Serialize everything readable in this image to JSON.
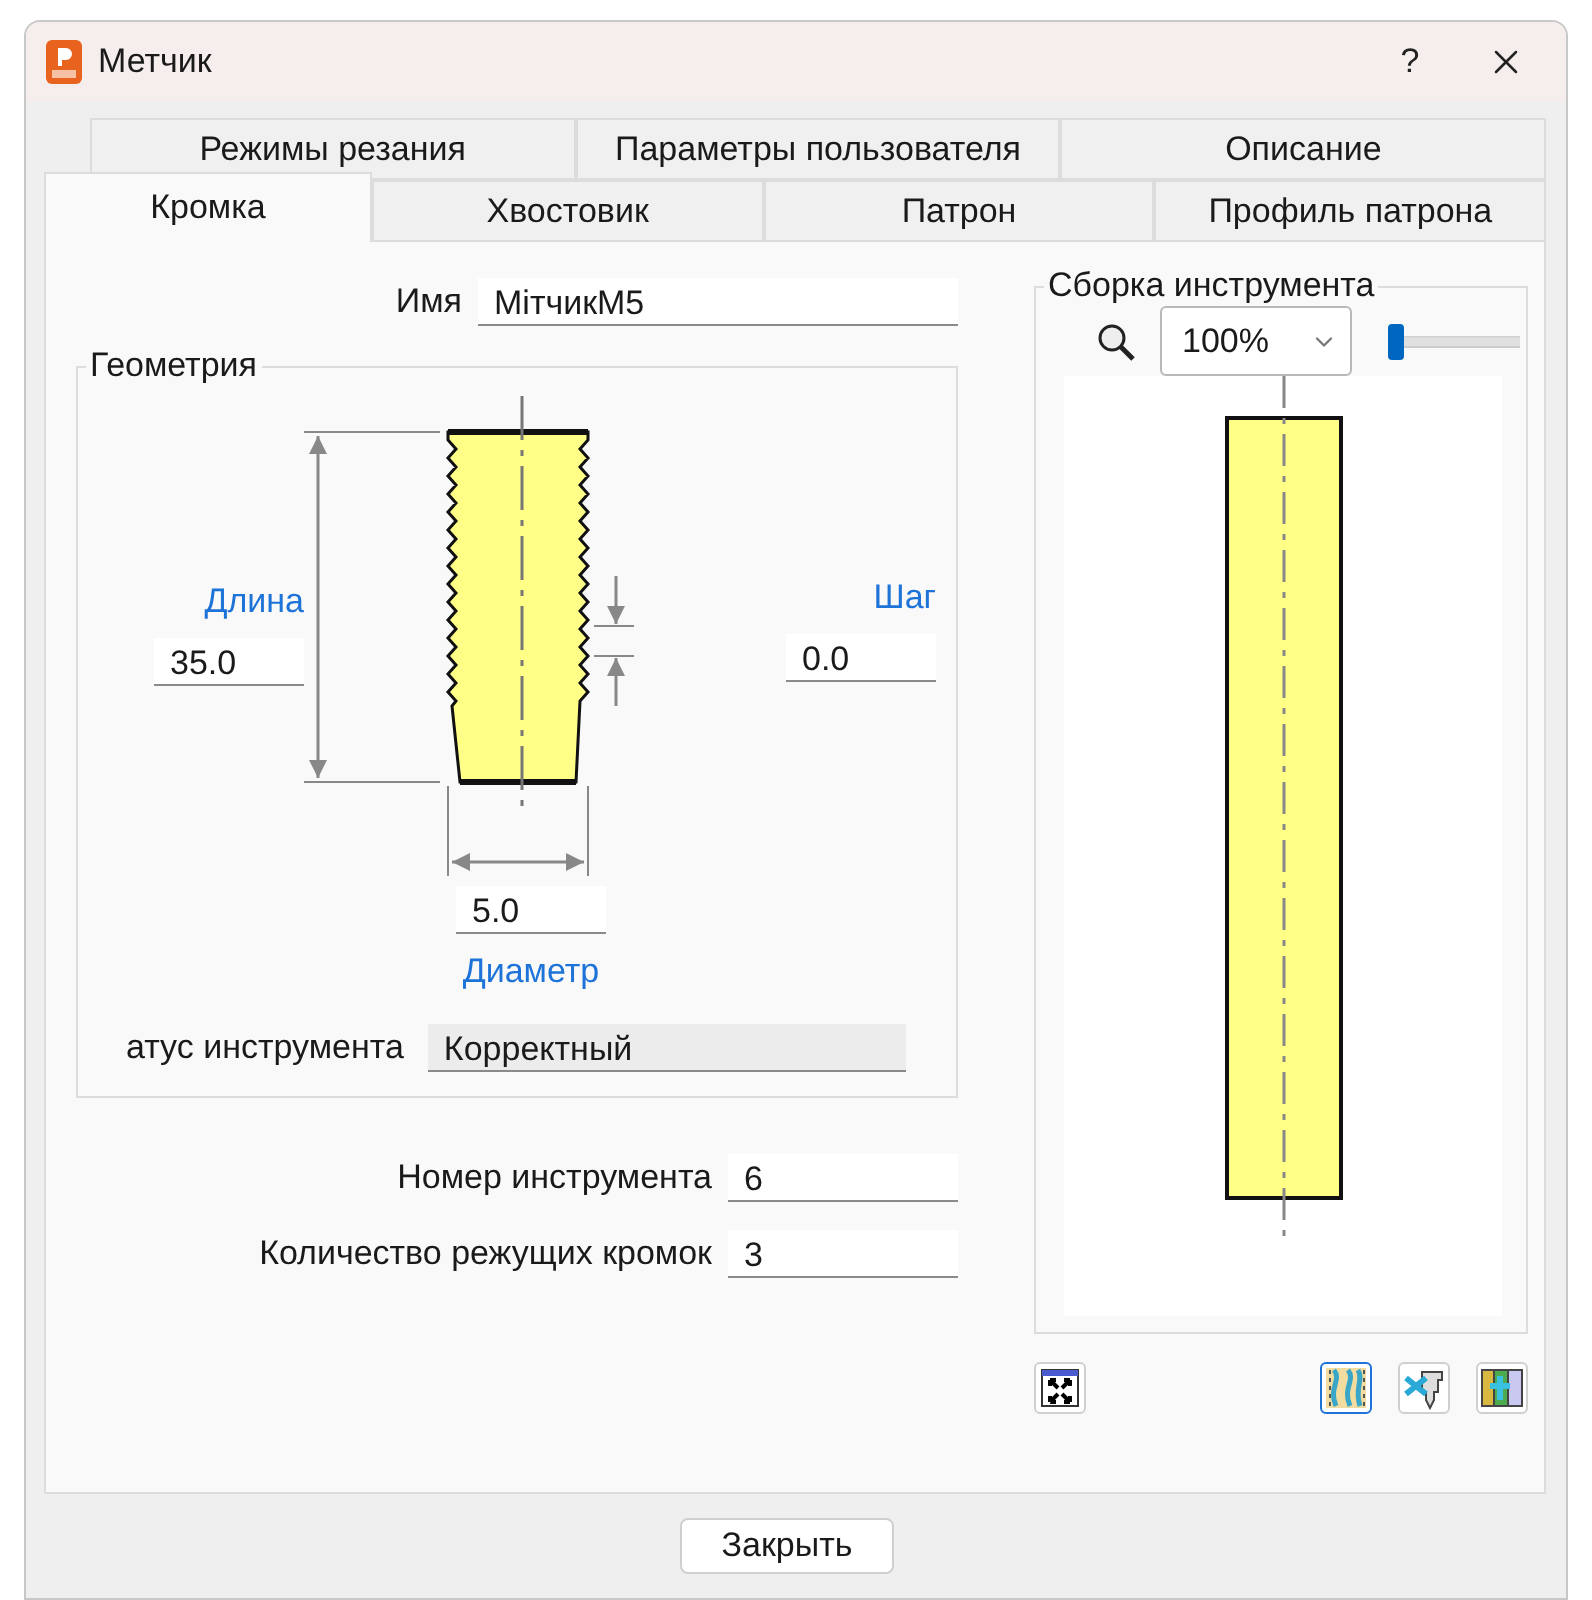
{
  "window": {
    "title": "Метчик",
    "help": "?"
  },
  "tab_rows": [
    [
      {
        "label": "Режимы резания",
        "selected": false
      },
      {
        "label": "Параметры пользователя",
        "selected": false
      },
      {
        "label": "Описание",
        "selected": false
      }
    ],
    [
      {
        "label": "Кромка",
        "selected": true
      },
      {
        "label": "Хвостовик",
        "selected": false
      },
      {
        "label": "Патрон",
        "selected": false
      },
      {
        "label": "Профиль патрона",
        "selected": false
      }
    ]
  ],
  "name": {
    "label": "Имя",
    "value": "МітчикM5"
  },
  "geometry": {
    "title": "Геометрия",
    "length": {
      "label": "Длина",
      "value": "35.0"
    },
    "pitch": {
      "label": "Шаг",
      "value": "0.0"
    },
    "diameter": {
      "label": "Диаметр",
      "value": "5.0"
    },
    "status": {
      "label": "атус инструмента",
      "value": "Корректный"
    }
  },
  "tool_number": {
    "label": "Номер инструмента",
    "value": "6"
  },
  "flutes": {
    "label": "Количество режущих кромок",
    "value": "3"
  },
  "assembly": {
    "title": "Сборка инструмента",
    "zoom": "100%",
    "zoom_slider": {
      "level": 0
    },
    "toolbar": [
      {
        "kind": "fit",
        "selected": false
      },
      {
        "kind": "profile",
        "selected": true
      },
      {
        "kind": "tool",
        "selected": false
      },
      {
        "kind": "holder",
        "selected": false
      }
    ]
  },
  "close_button": "Закрыть"
}
